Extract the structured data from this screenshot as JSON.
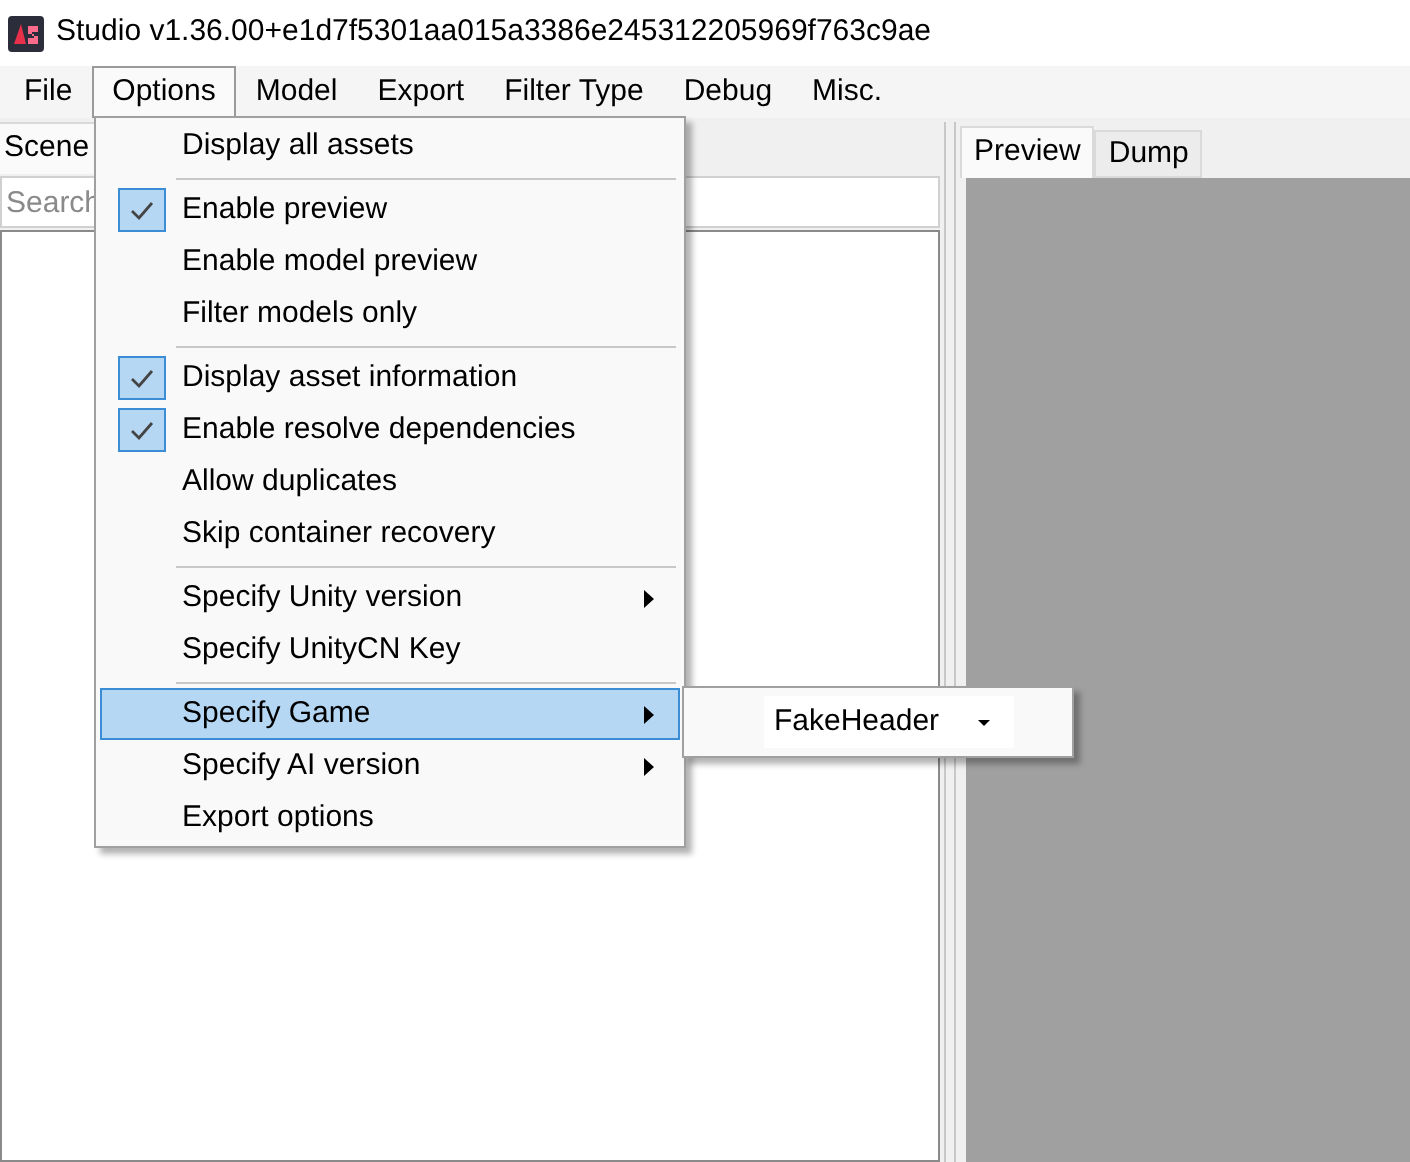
{
  "window": {
    "title": "Studio v1.36.00+e1d7f5301aa015a3386e245312205969f763c9ae"
  },
  "menu_bar": [
    {
      "label": "File",
      "selected": false
    },
    {
      "label": "Options",
      "selected": true
    },
    {
      "label": "Model",
      "selected": false
    },
    {
      "label": "Export",
      "selected": false
    },
    {
      "label": "Filter Type",
      "selected": false
    },
    {
      "label": "Debug",
      "selected": false
    },
    {
      "label": "Misc.",
      "selected": false
    }
  ],
  "left_panel": {
    "tabs": [
      {
        "label": "Scene",
        "selected": true
      }
    ],
    "search": {
      "placeholder": "Search"
    }
  },
  "right_panel": {
    "tabs": [
      {
        "label": "Preview",
        "selected": true
      },
      {
        "label": "Dump",
        "selected": false
      }
    ]
  },
  "options_menu": [
    {
      "kind": "item",
      "label": "Display all assets",
      "checked": false,
      "submenu": false,
      "selected": false
    },
    {
      "kind": "separator"
    },
    {
      "kind": "item",
      "label": "Enable preview",
      "checked": true,
      "submenu": false,
      "selected": false
    },
    {
      "kind": "item",
      "label": "Enable model preview",
      "checked": false,
      "submenu": false,
      "selected": false
    },
    {
      "kind": "item",
      "label": "Filter models only",
      "checked": false,
      "submenu": false,
      "selected": false
    },
    {
      "kind": "separator"
    },
    {
      "kind": "item",
      "label": "Display asset information",
      "checked": true,
      "submenu": false,
      "selected": false
    },
    {
      "kind": "item",
      "label": "Enable resolve dependencies",
      "checked": true,
      "submenu": false,
      "selected": false
    },
    {
      "kind": "item",
      "label": "Allow duplicates",
      "checked": false,
      "submenu": false,
      "selected": false
    },
    {
      "kind": "item",
      "label": "Skip container recovery",
      "checked": false,
      "submenu": false,
      "selected": false
    },
    {
      "kind": "separator"
    },
    {
      "kind": "item",
      "label": "Specify Unity version",
      "checked": false,
      "submenu": true,
      "selected": false
    },
    {
      "kind": "item",
      "label": "Specify UnityCN Key",
      "checked": false,
      "submenu": false,
      "selected": false
    },
    {
      "kind": "separator"
    },
    {
      "kind": "item",
      "label": "Specify Game",
      "checked": false,
      "submenu": true,
      "selected": true
    },
    {
      "kind": "item",
      "label": "Specify AI version",
      "checked": false,
      "submenu": true,
      "selected": false
    },
    {
      "kind": "item",
      "label": "Export options",
      "checked": false,
      "submenu": false,
      "selected": false
    }
  ],
  "game_submenu": {
    "value": "FakeHeader"
  }
}
